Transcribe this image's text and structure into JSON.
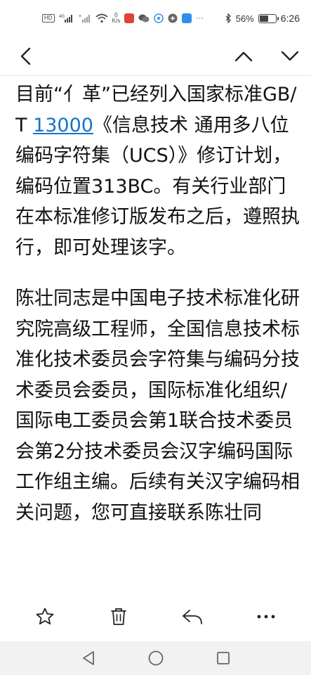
{
  "status_bar": {
    "hd_label": "HD",
    "network_speed": "0\nK/s",
    "battery_percent": "56%",
    "battery_level": 0.56,
    "time": "6:26",
    "icons": [
      "hd-icon",
      "signal-4g-icon",
      "signal-icon",
      "wifi-icon",
      "speed-icon",
      "app-icon-red",
      "wechat-icon",
      "app-icon-blue",
      "app-icon-gray",
      "search-app-icon",
      "more-dots-icon",
      "bluetooth-icon",
      "battery-icon"
    ]
  },
  "toolbar": {
    "back_icon": "chevron-left-icon",
    "prev_icon": "chevron-up-icon",
    "next_icon": "chevron-down-icon"
  },
  "article": {
    "p1_before_link": "目前“亻革”已经列入国家标准GB/T ",
    "p1_link": "13000",
    "p1_after_link": "《信息技术 通用多八位编码字符集（UCS）》修订计划，编码位置313BC。有关行业部门在本标准修订版发布之后，遵照执行，即可处理该字。",
    "p2": "陈壮同志是中国电子技术标准化研究院高级工程师，全国信息技术标准化技术委员会字符集与编码分技术委员会委员，国际标准化组织/国际电工委员会第1联合技术委员会第2分技术委员会汉字编码国际工作组主编。后续有关汉字编码相关问题，您可直接联系陈壮同"
  },
  "action_bar": {
    "icons": [
      "star-icon",
      "trash-icon",
      "reply-icon",
      "more-icon"
    ]
  },
  "nav_bar": {
    "icons": [
      "back-triangle-icon",
      "home-circle-icon",
      "recents-square-icon"
    ]
  },
  "colors": {
    "link": "#1a73c9",
    "text": "#111111",
    "nav_bg": "#f2f2f2"
  }
}
